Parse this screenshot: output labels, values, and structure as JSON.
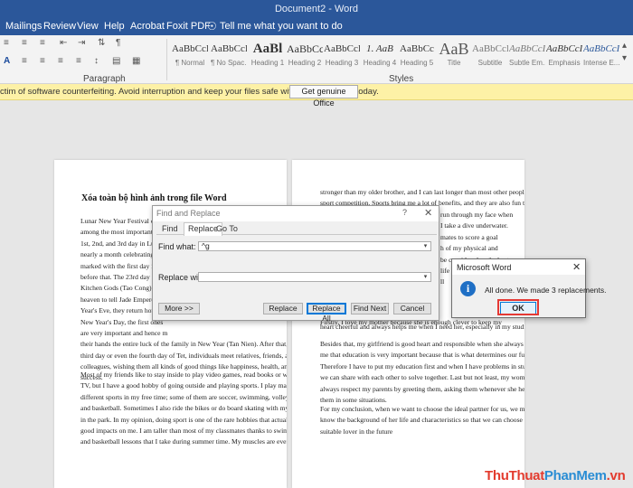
{
  "app": {
    "title": "Document2 - Word"
  },
  "menu": {
    "tabs": [
      "Mailings",
      "Review",
      "View",
      "Help",
      "Acrobat",
      "Foxit PDF"
    ],
    "tell_me": "Tell me what you want to do"
  },
  "ribbon": {
    "paragraph_label": "Paragraph",
    "styles_label": "Styles",
    "styles": [
      {
        "sample": "AaBbCcI",
        "name": "¶ Normal"
      },
      {
        "sample": "AaBbCcI",
        "name": "¶ No Spac..."
      },
      {
        "sample": "AaBl",
        "name": "Heading 1"
      },
      {
        "sample": "AaBbCc",
        "name": "Heading 2"
      },
      {
        "sample": "AaBbCcI",
        "name": "Heading 3"
      },
      {
        "sample": "1. AaB",
        "name": "Heading 4"
      },
      {
        "sample": "AaBbCc",
        "name": "Heading 5"
      },
      {
        "sample": "AaB",
        "name": "Title"
      },
      {
        "sample": "AaBbCcI",
        "name": "Subtitle"
      },
      {
        "sample": "AaBbCcI",
        "name": "Subtle Em..."
      },
      {
        "sample": "AaBbCcI",
        "name": "Emphasis"
      },
      {
        "sample": "AaBbCcI",
        "name": "Intense E..."
      }
    ]
  },
  "notification": {
    "message": "ctim of software counterfeiting. Avoid interruption and keep your files safe with genuine Office today.",
    "button": "Get genuine Office"
  },
  "page_left": {
    "title": "Xóa toàn bộ hình ảnh trong file Word",
    "para1": [
      "Lunar New Year Festival often",
      "among the most important holid",
      "1st, 2nd, and 3rd day in Lunar C",
      "nearly a month celebrating this",
      "marked with the first day in the",
      "before that. The 23rd day of the",
      "Kitchen Gods (Tao Cong). It tho",
      "heaven to tell Jade Emperor abo",
      "Year's Eve, they return home to",
      "New Year's Day, the first ones",
      "are very important and hence m",
      "their hands the entire luck of the family in New Year (Tan Nien). After that, till the",
      "third day or even the fourth day of Tet, individuals meet relatives, friends, and",
      "colleagues, wishing them all kinds of good things like happiness, health, and",
      "success."
    ],
    "para2": [
      "Most of my friends like to stay inside to play video games, read books or watch",
      "TV, but I have a good hobby of going outside and playing sports. I play many",
      "different sports in my free time; some of them are soccer, swimming, volleyball",
      "and basketball. Sometimes I also ride the bikes or do board skating with my cousin",
      "in the park. In my opinion, doing sport is one of the rare hobbies that actually have",
      "good impacts on me. I am taller than most of my classmates thanks to swimming",
      "and basketball lessons that I take during summer time. My muscles are even"
    ]
  },
  "page_right": {
    "para1": [
      "stronger than my older brother, and I can last longer than most other people in any",
      "sport competition. Sports bring me a lot of benefits, and they are also fun things to",
      "",
      "",
      "",
      "",
      "",
      "",
      "",
      "",
      "",
      "",
      "heart cheerful and always helps me when I need her, especially in my studies."
    ],
    "right_fragments": [
      "run through my face when",
      "I take a dive underwater.",
      "mates to score a goal",
      "h of my physical and",
      "be considered as the best",
      "life besides other",
      "ll"
    ],
    "wrap_line": "Firstly, I love my mother because she is enough clever to keep my",
    "para2": [
      "Besides that, my girlfriend is good heart and responsible when she always reminds",
      "me that education is very important because that is what determines our future."
    ],
    "para3": [
      "Therefore I have to put my education first and when I have problems in studying,",
      "we can share with each other to solve together. Last but not least, my woman",
      "always respect my parents by greeting them, asking them whenever she helping",
      "them in some situations."
    ],
    "para4": [
      "For my conclusion, when we want to choose the ideal partner for us, we must",
      "know the background of her life and characteristics so that we can choose a",
      "suitable lover in the future"
    ]
  },
  "find_replace": {
    "title": "Find and Replace",
    "help": "?",
    "tabs": [
      "Find",
      "Replace",
      "Go To"
    ],
    "find_label": "Find what:",
    "find_value": "^g",
    "replace_label": "Replace with:",
    "replace_value": "",
    "buttons": {
      "more": "More >>",
      "replace": "Replace",
      "replace_all": "Replace All",
      "find_next": "Find Next",
      "cancel": "Cancel"
    }
  },
  "message_box": {
    "title": "Microsoft Word",
    "message": "All done. We made 3 replacements.",
    "ok": "OK"
  },
  "watermark": {
    "part1": "ThuThuat",
    "part2": "PhanMem",
    "part3": ".vn"
  }
}
